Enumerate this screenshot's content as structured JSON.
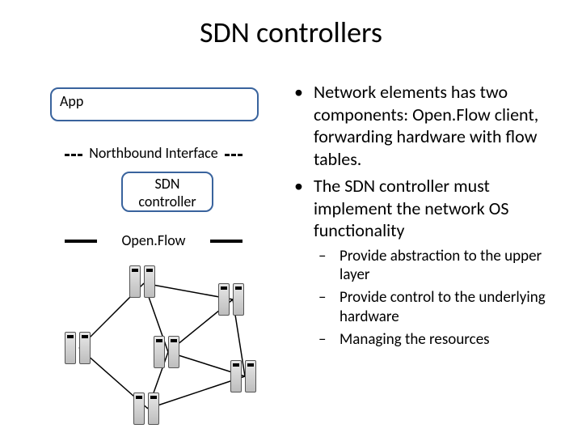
{
  "title": "SDN controllers",
  "diagram": {
    "app_label": "App",
    "northbound_label": "Northbound Interface",
    "sdn_box_line1": "SDN",
    "sdn_box_line2": "controller",
    "openflow_label": "Open.Flow"
  },
  "bullets": {
    "b1": "Network elements has two components: Open.Flow client, forwarding hardware with flow tables.",
    "b2": "The SDN controller must implement the network OS functionality",
    "sub1": "Provide abstraction to the upper layer",
    "sub2": "Provide control to the underlying hardware",
    "sub3": "Managing the resources"
  }
}
